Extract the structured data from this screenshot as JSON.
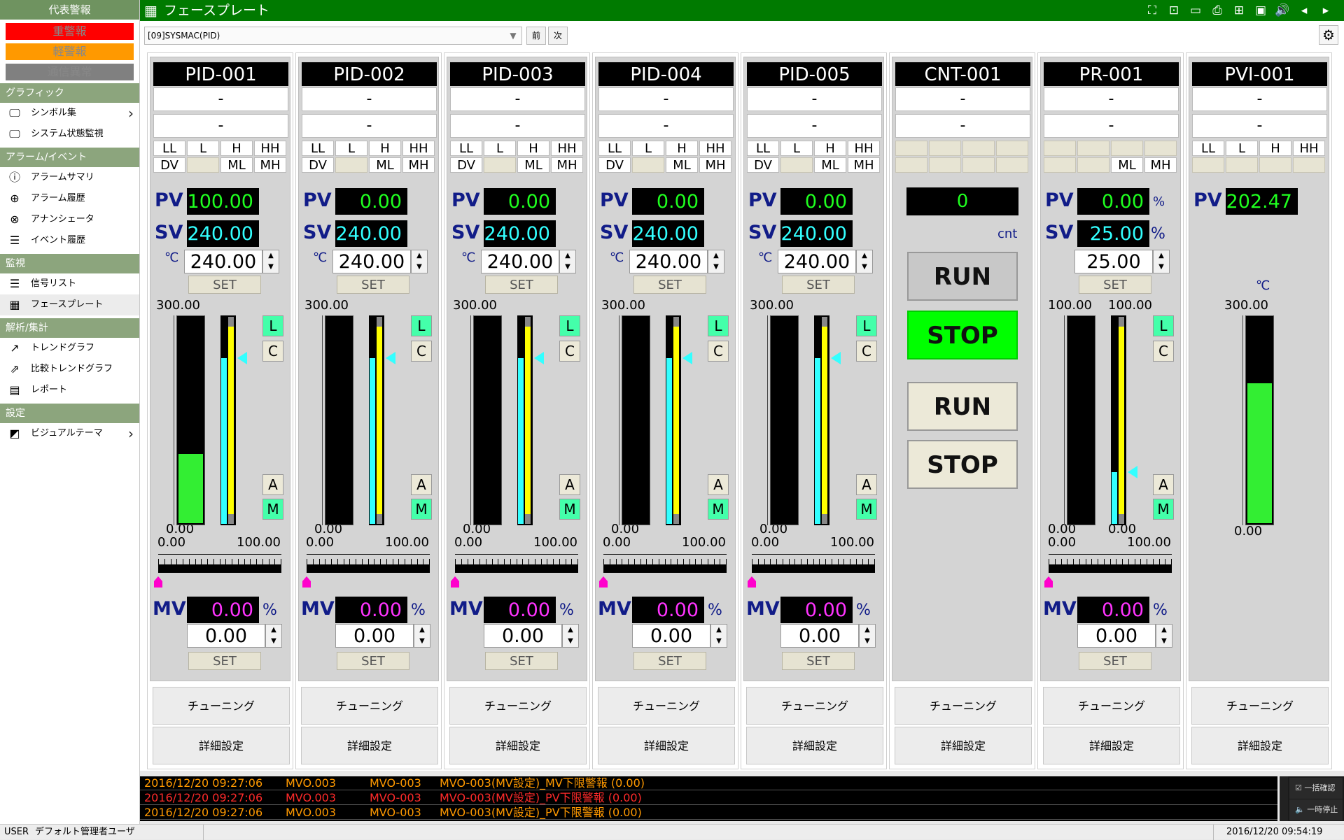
{
  "sidebar": {
    "title": "代表警報",
    "alarms": [
      {
        "label": "重警報",
        "bg": "#ff0000"
      },
      {
        "label": "軽警報",
        "bg": "#ff9900"
      },
      {
        "label": "通信異常",
        "bg": "#808080"
      }
    ],
    "sections": [
      {
        "label": "グラフィック",
        "items": [
          {
            "label": "シンボル集",
            "icon": "monitor-icon",
            "chevron": true
          },
          {
            "label": "システム状態監視",
            "icon": "monitor-icon"
          }
        ]
      },
      {
        "label": "アラーム/イベント",
        "items": [
          {
            "label": "アラームサマリ",
            "icon": "alarm-icon"
          },
          {
            "label": "アラーム履歴",
            "icon": "alarm-history-icon"
          },
          {
            "label": "アナンシェータ",
            "icon": "annunciator-icon"
          },
          {
            "label": "イベント履歴",
            "icon": "event-log-icon"
          }
        ]
      },
      {
        "label": "監視",
        "items": [
          {
            "label": "信号リスト",
            "icon": "list-icon"
          },
          {
            "label": "フェースプレート",
            "icon": "grid-icon",
            "selected": true
          }
        ]
      },
      {
        "label": "解析/集計",
        "items": [
          {
            "label": "トレンドグラフ",
            "icon": "trend-icon"
          },
          {
            "label": "比較トレンドグラフ",
            "icon": "compare-trend-icon"
          },
          {
            "label": "レポート",
            "icon": "report-icon"
          }
        ]
      },
      {
        "label": "設定",
        "items": [
          {
            "label": "ビジュアルテーマ",
            "icon": "theme-icon",
            "chevron": true
          }
        ]
      }
    ]
  },
  "header": {
    "title": "フェースプレート",
    "icons": [
      "expand-icon",
      "shrink-icon",
      "window-icon",
      "print-icon",
      "layout-icon",
      "monitor-icon",
      "sound-icon",
      "prev-icon",
      "next-icon"
    ]
  },
  "toolbar": {
    "selector_value": "[09]SYSMAC(PID)",
    "prev_label": "前",
    "next_label": "次"
  },
  "alarm_labels": {
    "ll": "LL",
    "l": "L",
    "h": "H",
    "hh": "HH",
    "dv": "DV",
    "ml": "ML",
    "mh": "MH"
  },
  "faceplates": [
    {
      "tag": "PID-001",
      "type": "pid",
      "comment1": "-",
      "comment2": "-",
      "pv": "100.00",
      "sv": "240.00",
      "sv_input": "240.00",
      "mv": "0.00",
      "mv_input": "0.00",
      "pv_unit": "℃",
      "mv_unit": "%",
      "scale_max": "300.00",
      "scale_min": "0.00",
      "mv_min": "0.00",
      "mv_max": "100.00",
      "pv_fraction": 0.333,
      "sv_fraction": 0.8,
      "mv_fraction": 0.0,
      "set_label": "SET"
    },
    {
      "tag": "PID-002",
      "type": "pid",
      "comment1": "-",
      "comment2": "-",
      "pv": "0.00",
      "sv": "240.00",
      "sv_input": "240.00",
      "mv": "0.00",
      "mv_input": "0.00",
      "pv_unit": "℃",
      "mv_unit": "%",
      "scale_max": "300.00",
      "scale_min": "0.00",
      "mv_min": "0.00",
      "mv_max": "100.00",
      "pv_fraction": 0.0,
      "sv_fraction": 0.8,
      "mv_fraction": 0.0,
      "set_label": "SET"
    },
    {
      "tag": "PID-003",
      "type": "pid",
      "comment1": "-",
      "comment2": "-",
      "pv": "0.00",
      "sv": "240.00",
      "sv_input": "240.00",
      "mv": "0.00",
      "mv_input": "0.00",
      "pv_unit": "℃",
      "mv_unit": "%",
      "scale_max": "300.00",
      "scale_min": "0.00",
      "mv_min": "0.00",
      "mv_max": "100.00",
      "pv_fraction": 0.0,
      "sv_fraction": 0.8,
      "mv_fraction": 0.0,
      "set_label": "SET"
    },
    {
      "tag": "PID-004",
      "type": "pid",
      "comment1": "-",
      "comment2": "-",
      "pv": "0.00",
      "sv": "240.00",
      "sv_input": "240.00",
      "mv": "0.00",
      "mv_input": "0.00",
      "pv_unit": "℃",
      "mv_unit": "%",
      "scale_max": "300.00",
      "scale_min": "0.00",
      "mv_min": "0.00",
      "mv_max": "100.00",
      "pv_fraction": 0.0,
      "sv_fraction": 0.8,
      "mv_fraction": 0.0,
      "set_label": "SET"
    },
    {
      "tag": "PID-005",
      "type": "pid",
      "comment1": "-",
      "comment2": "-",
      "pv": "0.00",
      "sv": "240.00",
      "sv_input": "240.00",
      "mv": "0.00",
      "mv_input": "0.00",
      "pv_unit": "℃",
      "mv_unit": "%",
      "scale_max": "300.00",
      "scale_min": "0.00",
      "mv_min": "0.00",
      "mv_max": "100.00",
      "pv_fraction": 0.0,
      "sv_fraction": 0.8,
      "mv_fraction": 0.0,
      "set_label": "SET"
    },
    {
      "tag": "CNT-001",
      "type": "cnt",
      "comment1": "-",
      "comment2": "-",
      "value": "0",
      "unit": "cnt",
      "run_label": "RUN",
      "stop_label": "STOP",
      "run_btn_label": "RUN",
      "stop_btn_label": "STOP",
      "status": "stop"
    },
    {
      "tag": "PR-001",
      "type": "pr",
      "comment1": "-",
      "comment2": "-",
      "pv": "0.00",
      "sv": "25.00",
      "sv_input": "25.00",
      "mv": "0.00",
      "mv_input": "0.00",
      "pv_unit": "%",
      "sv_unit": "%",
      "mv_unit": "%",
      "scale_max": "100.00",
      "scale_min": "0.00",
      "sv_scale_max": "100.00",
      "sv_scale_min": "0.00",
      "mv_min": "0.00",
      "mv_max": "100.00",
      "pv_fraction": 0.0,
      "sv_fraction": 0.25,
      "mv_fraction": 0.0,
      "set_label": "SET"
    },
    {
      "tag": "PVI-001",
      "type": "pvi",
      "comment1": "-",
      "comment2": "-",
      "pv": "202.47",
      "pv_unit": "℃",
      "scale_max": "300.00",
      "scale_min": "0.00",
      "pv_fraction": 0.675
    }
  ],
  "buttons": {
    "tuning": "チューニング",
    "detail": "詳細設定"
  },
  "modes": {
    "l": "L",
    "c": "C",
    "a": "A",
    "m": "M"
  },
  "alarm_log": [
    {
      "time": "2016/12/20 09:27:06",
      "tag": "MVO.003",
      "name": "MVO-003",
      "msg": "MVO-003(MV設定)_MV下限警報 (0.00)",
      "color": "#ff9900"
    },
    {
      "time": "2016/12/20 09:27:06",
      "tag": "MVO.003",
      "name": "MVO-003",
      "msg": "MVO-003(MV設定)_PV下限警報 (0.00)",
      "color": "#ff2a2a"
    },
    {
      "time": "2016/12/20 09:27:06",
      "tag": "MVO.003",
      "name": "MVO-003",
      "msg": "MVO-003(MV設定)_PV下限警報 (0.00)",
      "color": "#ff9900"
    }
  ],
  "log_buttons": {
    "ack": "一括確認",
    "pause": "一時停止"
  },
  "status": {
    "label": "USER",
    "user": "デフォルト管理者ユーザ",
    "datetime": "2016/12/20 09:54:19"
  },
  "colors": {
    "header_bg": "#007a00",
    "pv": "#1fff1f",
    "sv": "#33ffff",
    "mv": "#ff33ff",
    "stop_active": "#00ff00"
  }
}
